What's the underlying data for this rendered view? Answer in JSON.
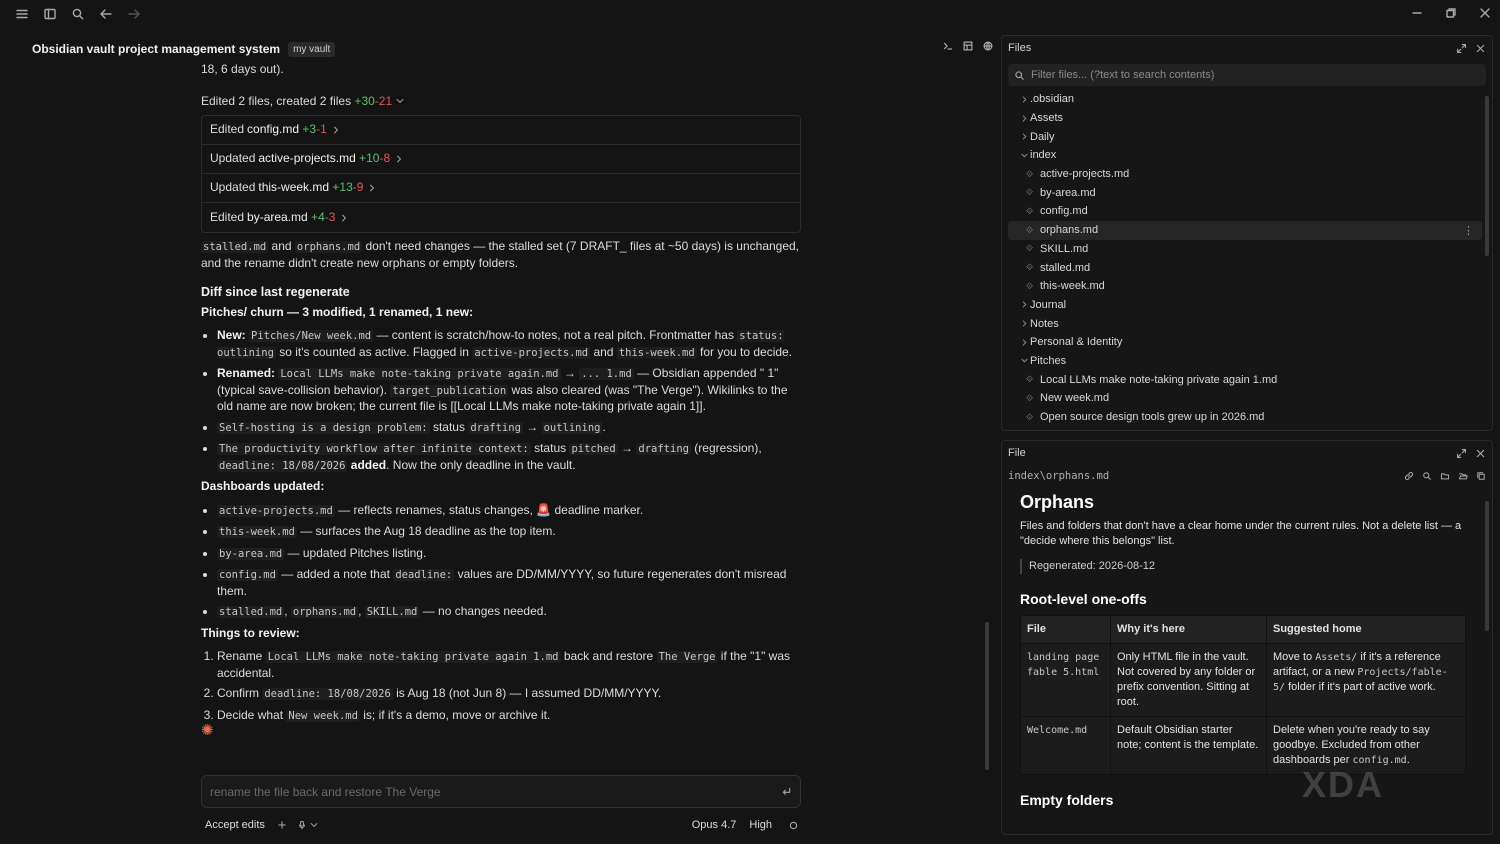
{
  "chat": {
    "title": "Obsidian vault project management system",
    "vault_badge": "my vault",
    "truncated_line": "18, 6 days out).",
    "edit_summary": {
      "label": "Edited 2 files, created 2 files",
      "added": "+30",
      "removed": "-21"
    },
    "edits": [
      {
        "verb": "Edited",
        "file": "config.md",
        "added": "+3",
        "removed": "-1"
      },
      {
        "verb": "Updated",
        "file": "active-projects.md",
        "added": "+10",
        "removed": "-8"
      },
      {
        "verb": "Updated",
        "file": "this-week.md",
        "added": "+13",
        "removed": "-9"
      },
      {
        "verb": "Edited",
        "file": "by-area.md",
        "added": "+4",
        "removed": "-3"
      }
    ],
    "para1": {
      "code1": "stalled.md",
      "t1": " and ",
      "code2": "orphans.md",
      "t2": " don't need changes — the stalled set (7 DRAFT_ files at ~50 days) is unchanged, and the rename didn't create new orphans or empty folders."
    },
    "diff_heading": "Diff since last regenerate",
    "pitches_heading": "Pitches/ churn — 3 modified, 1 renamed, 1 new:",
    "pitch_items": {
      "new": {
        "label": "New:",
        "code1": "Pitches/New week.md",
        "t1": " — content is scratch/how-to notes, not a real pitch. Frontmatter has ",
        "code2": "status: outlining",
        "t2": " so it's counted as active. Flagged in ",
        "code3": "active-projects.md",
        "t3": " and ",
        "code4": "this-week.md",
        "t4": " for you to decide."
      },
      "renamed": {
        "label": "Renamed:",
        "code1": "Local LLMs make note-taking private again.md",
        "arrow": " → ",
        "code2": "... 1.md",
        "t1": " — Obsidian appended \" 1\" (typical save-collision behavior). ",
        "code3": "target_publication",
        "t2": " was also cleared (was \"The Verge\"). Wikilinks to the old name are now broken; the current file is [[Local LLMs make note-taking private again 1]]."
      },
      "selfhost": {
        "code1": "Self-hosting is a design problem:",
        "t1": " status ",
        "code2": "drafting",
        "arrow": " → ",
        "code3": "outlining",
        "t2": "."
      },
      "productivity": {
        "code1": "The productivity workflow after infinite context:",
        "t1": " status ",
        "code2": "pitched",
        "arrow": " → ",
        "code3": "drafting",
        "t2": " (regression), ",
        "code4": "deadline: 18/08/2026",
        "t3": " added",
        "t4": ". Now the only deadline in the vault."
      }
    },
    "dash_heading": "Dashboards updated:",
    "dash_items": [
      {
        "code": "active-projects.md",
        "text": " — reflects renames, status changes, 🚨 deadline marker."
      },
      {
        "code": "this-week.md",
        "text": " — surfaces the Aug 18 deadline as the top item."
      },
      {
        "code": "by-area.md",
        "text": " — updated Pitches listing."
      },
      {
        "code": "config.md",
        "text": " — added a note that ",
        "code2": "deadline:",
        "text2": " values are DD/MM/YYYY, so future regenerates don't misread them."
      },
      {
        "code": "stalled.md",
        "sep1": ", ",
        "code_b": "orphans.md",
        "sep2": ", ",
        "code_c": "SKILL.md",
        "text": " — no changes needed."
      }
    ],
    "review_heading": "Things to review:",
    "review_items": [
      {
        "t1": "Rename ",
        "code1": "Local LLMs make note-taking private again 1.md",
        "t2": " back and restore ",
        "code2": "The Verge",
        "t3": " if the \"1\" was accidental."
      },
      {
        "t1": "Confirm ",
        "code1": "deadline: 18/08/2026",
        "t2": " is Aug 18 (not Jun 8) — I assumed DD/MM/YYYY."
      },
      {
        "t1": "Decide what ",
        "code1": "New week.md",
        "t2": " is; if it's a demo, move or archive it."
      }
    ],
    "spinner_glyph": "✺"
  },
  "composer": {
    "placeholder": "rename the file back and restore The Verge",
    "accept_edits": "Accept edits",
    "model": "Opus 4.7",
    "effort": "High"
  },
  "files_pane": {
    "title": "Files",
    "filter_placeholder": "Filter files... (?text to search contents)",
    "tree": [
      {
        "name": ".obsidian",
        "type": "folder",
        "open": false
      },
      {
        "name": "Assets",
        "type": "folder",
        "open": false
      },
      {
        "name": "Daily",
        "type": "folder",
        "open": false
      },
      {
        "name": "index",
        "type": "folder",
        "open": true
      },
      {
        "name": "active-projects.md",
        "type": "file"
      },
      {
        "name": "by-area.md",
        "type": "file"
      },
      {
        "name": "config.md",
        "type": "file"
      },
      {
        "name": "orphans.md",
        "type": "file",
        "selected": true
      },
      {
        "name": "SKILL.md",
        "type": "file"
      },
      {
        "name": "stalled.md",
        "type": "file"
      },
      {
        "name": "this-week.md",
        "type": "file"
      },
      {
        "name": "Journal",
        "type": "folder",
        "open": false
      },
      {
        "name": "Notes",
        "type": "folder",
        "open": false
      },
      {
        "name": "Personal & Identity",
        "type": "folder",
        "open": false
      },
      {
        "name": "Pitches",
        "type": "folder",
        "open": true
      },
      {
        "name": "Local LLMs make note-taking private again 1.md",
        "type": "file"
      },
      {
        "name": "New week.md",
        "type": "file"
      },
      {
        "name": "Open source design tools grew up in 2026.md",
        "type": "file"
      }
    ]
  },
  "file_pane": {
    "title": "File",
    "path": "index\\orphans.md",
    "doc": {
      "h1": "Orphans",
      "intro": "Files and folders that don't have a clear home under the current rules. Not a delete list — a \"decide where this belongs\" list.",
      "quote": "Regenerated: 2026-08-12",
      "h2": "Root-level one-offs",
      "table_headers": [
        "File",
        "Why it's here",
        "Suggested home"
      ],
      "rows": [
        {
          "file": "landing page fable 5.html",
          "why": "Only HTML file in the vault. Not covered by any folder or prefix convention. Sitting at root.",
          "home_t1": "Move to ",
          "home_c1": "Assets/",
          "home_t2": " if it's a reference artifact, or a new ",
          "home_c2": "Projects/fable-5/",
          "home_t3": " folder if it's part of active work."
        },
        {
          "file": "Welcome.md",
          "why": "Default Obsidian starter note; content is the template.",
          "home_t1": "Delete when you're ready to say goodbye. Excluded from other dashboards per ",
          "home_c1": "config.md",
          "home_t2": ".",
          "home_c2": "",
          "home_t3": ""
        }
      ],
      "h2b": "Empty folders"
    },
    "watermark": "XDA"
  },
  "colors": {
    "added": "#5fbf6f",
    "removed": "#e05555",
    "accent": "#e0724a"
  }
}
